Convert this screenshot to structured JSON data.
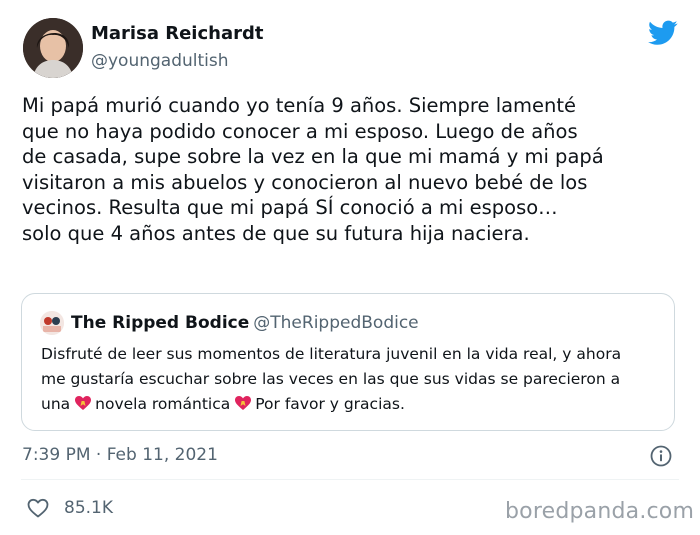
{
  "author": {
    "name": "Marisa Reichardt",
    "handle": "@youngadultish"
  },
  "tweet": {
    "lines": [
      "Mi papá murió cuando yo tenía 9 años. Siempre lamenté",
      "que no haya podido conocer a mi esposo. Luego de años",
      "de casada, supe sobre la vez en la que mi mamá y mi papá",
      "visitaron a mis abuelos y conocieron al nuevo bebé de los",
      "vecinos. Resulta que mi papá SÍ conoció a mi esposo…",
      "solo que 4 años antes de que su futura hija naciera."
    ]
  },
  "quoted_tweet": {
    "name": "The Ripped Bodice",
    "handle": "@TheRippedBodice",
    "line1": "Disfruté de leer sus momentos de literatura juvenil en la vida real, y ahora",
    "line2": "me gustaría escuchar sobre las veces en las que sus vidas se parecieron a",
    "line3_start": "una",
    "line3_middle": "novela romántica",
    "line3_end": "Por favor y gracias."
  },
  "meta": {
    "timestamp": "7:39 PM · Feb 11, 2021",
    "likes": "85.1K"
  },
  "watermark": "boredpanda.com",
  "icons": {
    "brand": "twitter-bird-icon",
    "info": "info-icon",
    "like": "heart-outline-icon",
    "emoji": "heart-with-ribbon-emoji"
  },
  "colors": {
    "twitter_blue": "#1d9bf0",
    "text_primary": "#0f1419",
    "text_secondary": "#536471",
    "border": "#cfd9de",
    "emoji_red": "#e0245e",
    "emoji_ribbon": "#f4c23b"
  }
}
